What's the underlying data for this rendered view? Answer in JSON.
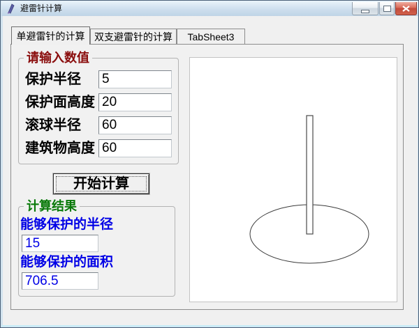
{
  "window": {
    "title": "避雷针计算",
    "controls": {
      "minimize": "minimize",
      "maximize": "maximize",
      "close": "close"
    }
  },
  "tabs": [
    {
      "label": "单避雷针的计算",
      "active": true
    },
    {
      "label": "双支避雷针的计算",
      "active": false
    },
    {
      "label": "TabSheet3",
      "active": false
    }
  ],
  "input_group": {
    "title": "请输入数值",
    "fields": [
      {
        "label": "保护半径",
        "value": "5"
      },
      {
        "label": "保护面高度",
        "value": "20"
      },
      {
        "label": "滚球半径",
        "value": "60"
      },
      {
        "label": "建筑物高度",
        "value": "60"
      }
    ]
  },
  "calculate_button": {
    "label": "开始计算"
  },
  "result_group": {
    "title": "计算结果",
    "fields": [
      {
        "label": "能够保护的半径",
        "value": "15"
      },
      {
        "label": "能够保护的面积",
        "value": "706.5"
      }
    ]
  },
  "colors": {
    "accent_maroon": "#8a0d0d",
    "accent_green": "#0a7a0a",
    "accent_blue": "#0000e6",
    "close_red": "#c24a3a",
    "titlebar_blue": "#cedfee"
  }
}
